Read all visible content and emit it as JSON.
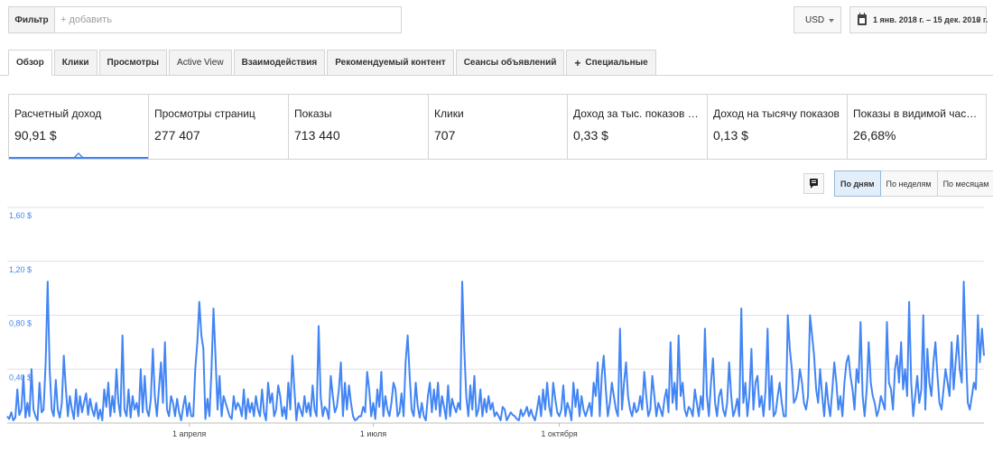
{
  "filter": {
    "label": "Фильтр",
    "placeholder": "+ добавить"
  },
  "currency": {
    "value": "USD"
  },
  "date_range": {
    "label": "1 янв. 2018 г. – 15 дек. 2018 г."
  },
  "tabs": [
    {
      "label": "Обзор",
      "active": true
    },
    {
      "label": "Клики"
    },
    {
      "label": "Просмотры"
    },
    {
      "label": "Active View"
    },
    {
      "label": "Взаимодействия"
    },
    {
      "label": "Рекомендуемый контент"
    },
    {
      "label": "Сеансы объявлений"
    },
    {
      "label": "Специальные",
      "icon": "plus-icon"
    }
  ],
  "metrics": [
    {
      "label": "Расчетный доход",
      "value": "90,91 $",
      "selected": true
    },
    {
      "label": "Просмотры страниц",
      "value": "277 407"
    },
    {
      "label": "Показы",
      "value": "713 440"
    },
    {
      "label": "Клики",
      "value": "707"
    },
    {
      "label": "Доход за тыс. показов страни…",
      "value": "0,33 $"
    },
    {
      "label": "Доход на тысячу показов",
      "value": "0,13 $"
    },
    {
      "label": "Показы в видимой части экра…",
      "value": "26,68%"
    }
  ],
  "granularity": [
    {
      "label": "По дням",
      "active": true
    },
    {
      "label": "По неделям"
    },
    {
      "label": "По месяцам"
    }
  ],
  "colors": {
    "accent": "#4285f4",
    "line": "#4285f4",
    "grid": "#e0e0e0",
    "axis_text": "#4285f4"
  },
  "chart_data": {
    "type": "line",
    "ylim": [
      0,
      1.6
    ],
    "y_ticks": [
      "0,40 $",
      "0,80 $",
      "1,20 $",
      "1,60 $"
    ],
    "y_tick_values": [
      0.4,
      0.8,
      1.2,
      1.6
    ],
    "x_tick_labels": [
      "1 апреля",
      "1 июля",
      "1 октября"
    ],
    "x_tick_days": [
      90,
      181,
      273
    ],
    "x_start": "2018-01-01",
    "x_end": "2018-12-15",
    "series": [
      {
        "values": [
          0.05,
          0.03,
          0.08,
          0.02,
          0.04,
          0.25,
          0.06,
          0.1,
          0.35,
          0.04,
          0.15,
          0.05,
          0.4,
          0.1,
          0.05,
          0.02,
          0.3,
          0.08,
          0.1,
          0.45,
          1.05,
          0.4,
          0.1,
          0.05,
          0.32,
          0.1,
          0.04,
          0.15,
          0.5,
          0.25,
          0.05,
          0.2,
          0.1,
          0.03,
          0.25,
          0.05,
          0.2,
          0.08,
          0.15,
          0.22,
          0.06,
          0.18,
          0.1,
          0.05,
          0.15,
          0.03,
          0.1,
          0.02,
          0.25,
          0.12,
          0.3,
          0.05,
          0.2,
          0.08,
          0.4,
          0.15,
          0.05,
          0.65,
          0.1,
          0.05,
          0.25,
          0.04,
          0.2,
          0.1,
          0.15,
          0.05,
          0.4,
          0.08,
          0.35,
          0.1,
          0.05,
          0.18,
          0.55,
          0.2,
          0.05,
          0.25,
          0.45,
          0.15,
          0.6,
          0.1,
          0.05,
          0.2,
          0.15,
          0.05,
          0.18,
          0.08,
          0.02,
          0.12,
          0.2,
          0.05,
          0.15,
          0.05,
          0.05,
          0.4,
          0.6,
          0.9,
          0.65,
          0.55,
          0.03,
          0.18,
          0.05,
          0.4,
          0.85,
          0.5,
          0.1,
          0.35,
          0.05,
          0.2,
          0.15,
          0.1,
          0.05,
          0.03,
          0.2,
          0.1,
          0.15,
          0.12,
          0.05,
          0.25,
          0.03,
          0.18,
          0.08,
          0.15,
          0.05,
          0.2,
          0.1,
          0.05,
          0.25,
          0.08,
          0.02,
          0.3,
          0.15,
          0.22,
          0.05,
          0.1,
          0.28,
          0.2,
          0.05,
          0.12,
          0.03,
          0.3,
          0.1,
          0.5,
          0.25,
          0.02,
          0.15,
          0.1,
          0.05,
          0.2,
          0.08,
          0.15,
          0.05,
          0.28,
          0.1,
          0.05,
          0.72,
          0.2,
          0.05,
          0.12,
          0.1,
          0.03,
          0.35,
          0.2,
          0.08,
          0.12,
          0.25,
          0.45,
          0.05,
          0.3,
          0.1,
          0.28,
          0.15,
          0.05,
          0.02,
          0.03,
          0.05,
          0.05,
          0.12,
          0.08,
          0.38,
          0.25,
          0.05,
          0.15,
          0.03,
          0.25,
          0.12,
          0.38,
          0.05,
          0.2,
          0.1,
          0.05,
          0.15,
          0.3,
          0.25,
          0.05,
          0.08,
          0.22,
          0.05,
          0.45,
          0.65,
          0.35,
          0.1,
          0.05,
          0.3,
          0.12,
          0.04,
          0.15,
          0.05,
          0.02,
          0.2,
          0.3,
          0.08,
          0.25,
          0.1,
          0.3,
          0.05,
          0.2,
          0.12,
          0.03,
          0.28,
          0.05,
          0.18,
          0.12,
          0.08,
          0.15,
          0.1,
          1.05,
          0.55,
          0.2,
          0.05,
          0.28,
          0.1,
          0.35,
          0.05,
          0.1,
          0.25,
          0.05,
          0.18,
          0.08,
          0.2,
          0.1,
          0.15,
          0.05,
          0.08,
          0.05,
          0.02,
          0.12,
          0.1,
          0.02,
          0.05,
          0.08,
          0.06,
          0.05,
          0.03,
          0.02,
          0.1,
          0.05,
          0.08,
          0.12,
          0.05,
          0.1,
          0.05,
          0.02,
          0.1,
          0.2,
          0.05,
          0.25,
          0.1,
          0.3,
          0.12,
          0.05,
          0.3,
          0.18,
          0.08,
          0.05,
          0.1,
          0.28,
          0.05,
          0.15,
          0.1,
          0.02,
          0.3,
          0.12,
          0.25,
          0.05,
          0.2,
          0.1,
          0.05,
          0.1,
          0.15,
          0.05,
          0.3,
          0.2,
          0.45,
          0.05,
          0.35,
          0.5,
          0.25,
          0.05,
          0.15,
          0.3,
          0.2,
          0.1,
          0.05,
          0.7,
          0.1,
          0.3,
          0.45,
          0.2,
          0.1,
          0.05,
          0.15,
          0.08,
          0.1,
          0.2,
          0.1,
          0.38,
          0.2,
          0.05,
          0.1,
          0.35,
          0.2,
          0.05,
          0.15,
          0.1,
          0.05,
          0.18,
          0.25,
          0.08,
          0.6,
          0.15,
          0.3,
          0.1,
          0.65,
          0.2,
          0.3,
          0.1,
          0.05,
          0.12,
          0.1,
          0.05,
          0.25,
          0.15,
          0.05,
          0.2,
          0.1,
          0.7,
          0.2,
          0.05,
          0.3,
          0.48,
          0.15,
          0.05,
          0.2,
          0.25,
          0.1,
          0.05,
          0.15,
          0.45,
          0.2,
          0.05,
          0.1,
          0.18,
          0.05,
          0.85,
          0.15,
          0.3,
          0.05,
          0.2,
          0.55,
          0.1,
          0.3,
          0.35,
          0.12,
          0.2,
          0.05,
          0.25,
          0.7,
          0.1,
          0.35,
          0.05,
          0.08,
          0.2,
          0.3,
          0.15,
          0.05,
          0.05,
          0.8,
          0.55,
          0.4,
          0.15,
          0.18,
          0.25,
          0.4,
          0.3,
          0.15,
          0.1,
          0.2,
          0.8,
          0.65,
          0.5,
          0.25,
          0.15,
          0.4,
          0.2,
          0.05,
          0.3,
          0.15,
          0.05,
          0.25,
          0.45,
          0.3,
          0.1,
          0.2,
          0.05,
          0.3,
          0.45,
          0.5,
          0.35,
          0.25,
          0.1,
          0.4,
          0.3,
          0.75,
          0.2,
          0.05,
          0.25,
          0.6,
          0.3,
          0.2,
          0.15,
          0.05,
          0.1,
          0.2,
          0.15,
          0.1,
          0.75,
          0.3,
          0.25,
          0.1,
          0.4,
          0.5,
          0.3,
          0.6,
          0.25,
          0.4,
          0.2,
          0.9,
          0.3,
          0.05,
          0.2,
          0.35,
          0.15,
          0.25,
          0.8,
          0.1,
          0.55,
          0.3,
          0.2,
          0.45,
          0.6,
          0.35,
          0.15,
          0.1,
          0.25,
          0.4,
          0.3,
          0.2,
          0.6,
          0.25,
          0.45,
          0.65,
          0.4,
          0.3,
          1.05,
          0.55,
          0.15,
          0.1,
          0.2,
          0.3,
          0.25,
          0.8,
          0.45,
          0.7,
          0.5
        ]
      }
    ]
  }
}
